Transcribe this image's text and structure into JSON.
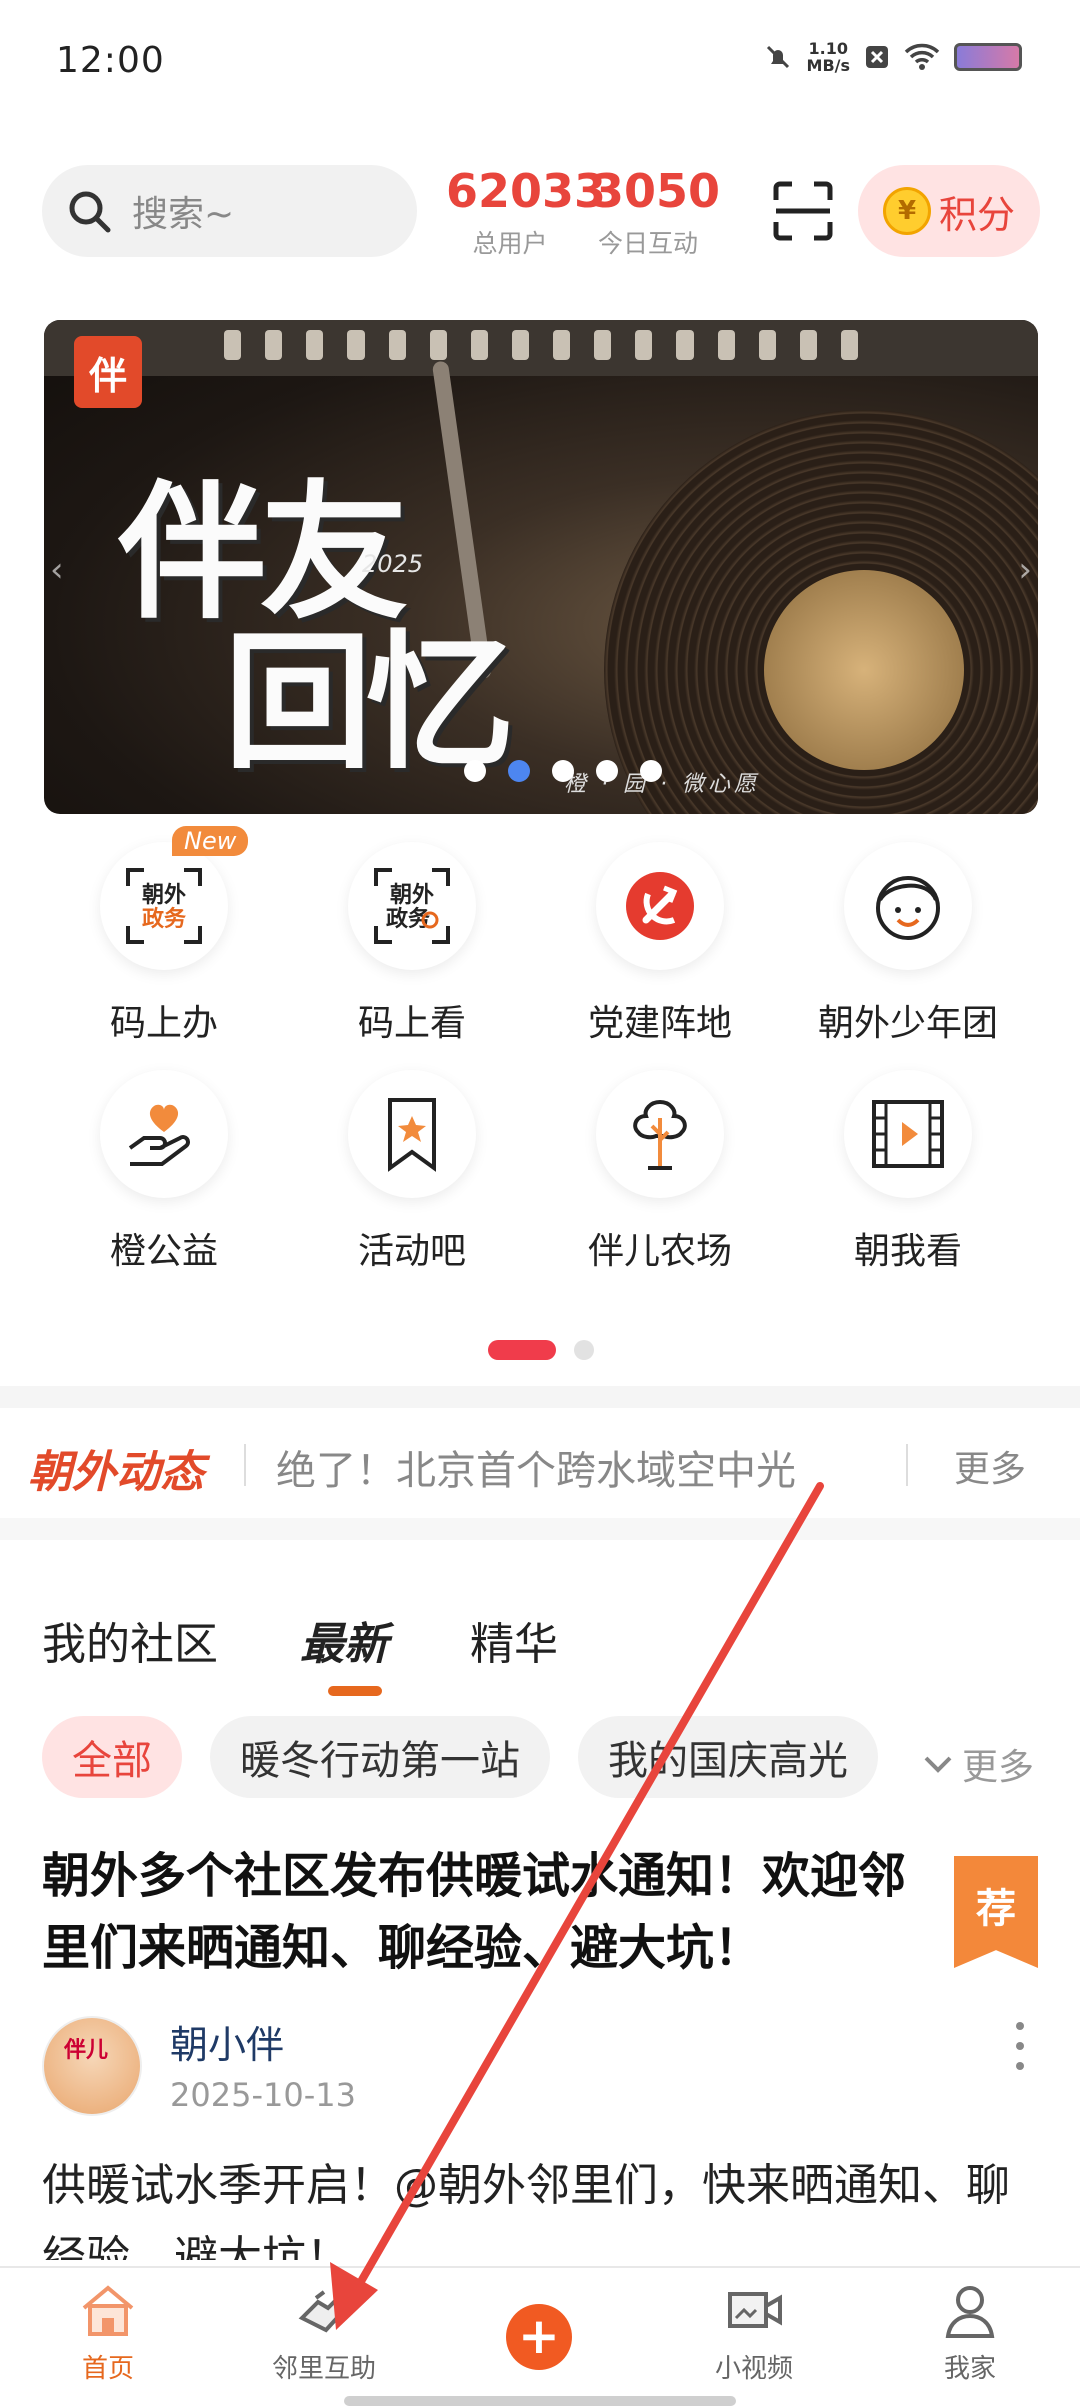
{
  "status_bar": {
    "time": "12:00",
    "net_speed": "1.10",
    "net_unit": "MB/s"
  },
  "header": {
    "search_placeholder": "搜索~",
    "stats": [
      {
        "value": "62033",
        "label": "总用户"
      },
      {
        "value": "3050",
        "label": "今日互动"
      }
    ],
    "points_label": "积分"
  },
  "banner": {
    "logo_text": "伴",
    "title_line1": "伴友",
    "title_line2": "回忆",
    "year": "2025",
    "slogan": "橙 · 园 · 微心愿",
    "dots": 5,
    "active_dot": 1
  },
  "grid": {
    "new_badge": "New",
    "items": [
      {
        "label": "码上办",
        "icon": "qr-gov-service-icon"
      },
      {
        "label": "码上看",
        "icon": "qr-gov-search-icon"
      },
      {
        "label": "党建阵地",
        "icon": "party-emblem-icon"
      },
      {
        "label": "朝外少年团",
        "icon": "kid-face-icon"
      },
      {
        "label": "橙公益",
        "icon": "hand-heart-icon"
      },
      {
        "label": "活动吧",
        "icon": "bookmark-star-icon"
      },
      {
        "label": "伴儿农场",
        "icon": "tree-icon"
      },
      {
        "label": "朝我看",
        "icon": "film-play-icon"
      }
    ]
  },
  "ticker": {
    "brand": "朝外动态",
    "headline": "绝了！北京首个跨水域空中光",
    "more": "更多"
  },
  "tabs": [
    {
      "label": "我的社区",
      "active": false
    },
    {
      "label": "最新",
      "active": true
    },
    {
      "label": "精华",
      "active": false
    }
  ],
  "chips": {
    "items": [
      "全部",
      "暖冬行动第一站",
      "我的国庆高光"
    ],
    "active_index": 0,
    "more": "更多"
  },
  "post": {
    "title": "朝外多个社区发布供暖试水通知！欢迎邻里们来晒通知、聊经验、避大坑！",
    "badge": "荐",
    "avatar_text": "伴儿",
    "author": "朝小伴",
    "date": "2025-10-13",
    "body": "供暖试水季开启！@朝外邻里们，快来晒通知、聊经验、避大坑！"
  },
  "bottom_nav": {
    "items": [
      {
        "label": "首页",
        "active": true
      },
      {
        "label": "邻里互助",
        "active": false
      },
      {
        "label": "",
        "active": false
      },
      {
        "label": "小视频",
        "active": false
      },
      {
        "label": "我家",
        "active": false
      }
    ],
    "plus": "+"
  },
  "colors": {
    "accent": "#e8453c",
    "orange": "#e6681e",
    "annotation": "#e8453c"
  }
}
